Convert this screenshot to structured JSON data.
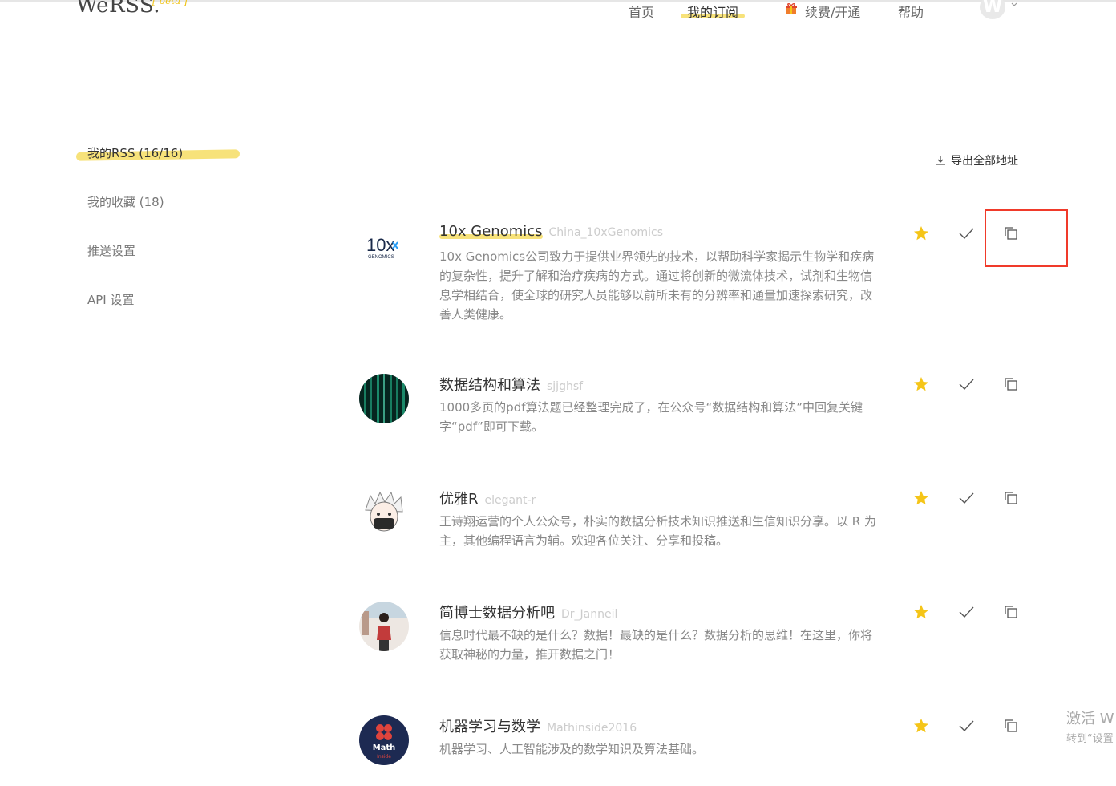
{
  "brand": {
    "logo": "WeRSS.",
    "badge": "[ beta ]"
  },
  "nav": {
    "items": [
      {
        "label": "首页"
      },
      {
        "label": "我的订阅"
      },
      {
        "label": "续费/开通"
      },
      {
        "label": "帮助"
      }
    ],
    "avatar_letter": "W"
  },
  "sidebar": {
    "items": [
      {
        "label": "我的RSS (16/16)"
      },
      {
        "label": "我的收藏 (18)"
      },
      {
        "label": "推送设置"
      },
      {
        "label": "API 设置"
      }
    ]
  },
  "toolbar": {
    "export_label": "导出全部地址"
  },
  "feeds": [
    {
      "name": "10x Genomics",
      "account": "China_10xGenomics",
      "description": "10x Genomics公司致力于提供业界领先的技术，以帮助科学家揭示生物学和疾病的复杂性，提升了解和治疗疾病的方式。通过将创新的微流体技术，试剂和生物信息学相结合，使全球的研究人员能够以前所未有的分辨率和通量加速探索研究，改善人类健康。",
      "logo_text": "10x",
      "logo_sub": "GENOMICS"
    },
    {
      "name": "数据结构和算法",
      "account": "sjjghsf",
      "description": "1000多页的pdf算法题已经整理完成了，在公众号“数据结构和算法”中回复关键字“pdf”即可下载。"
    },
    {
      "name": "优雅R",
      "account": "elegant-r",
      "description": "王诗翔运营的个人公众号，朴实的数据分析技术知识推送和生信知识分享。以 R 为主，其他编程语言为辅。欢迎各位关注、分享和投稿。"
    },
    {
      "name": "简博士数据分析吧",
      "account": "Dr_Janneil",
      "description": "信息时代最不缺的是什么？数据！最缺的是什么？数据分析的思维！在这里，你将获取神秘的力量，推开数据之门！"
    },
    {
      "name": "机器学习与数学",
      "account": "Mathinside2016",
      "description": "机器学习、人工智能涉及的数学知识及算法基础。",
      "logo_text": "Math",
      "logo_sub": "Inside"
    }
  ],
  "watermark": {
    "line1": "激活 W",
    "line2": "转到“设置"
  },
  "colors": {
    "highlight": "#f7e27a",
    "star": "#f5c518",
    "annotation": "#f03a2a"
  }
}
